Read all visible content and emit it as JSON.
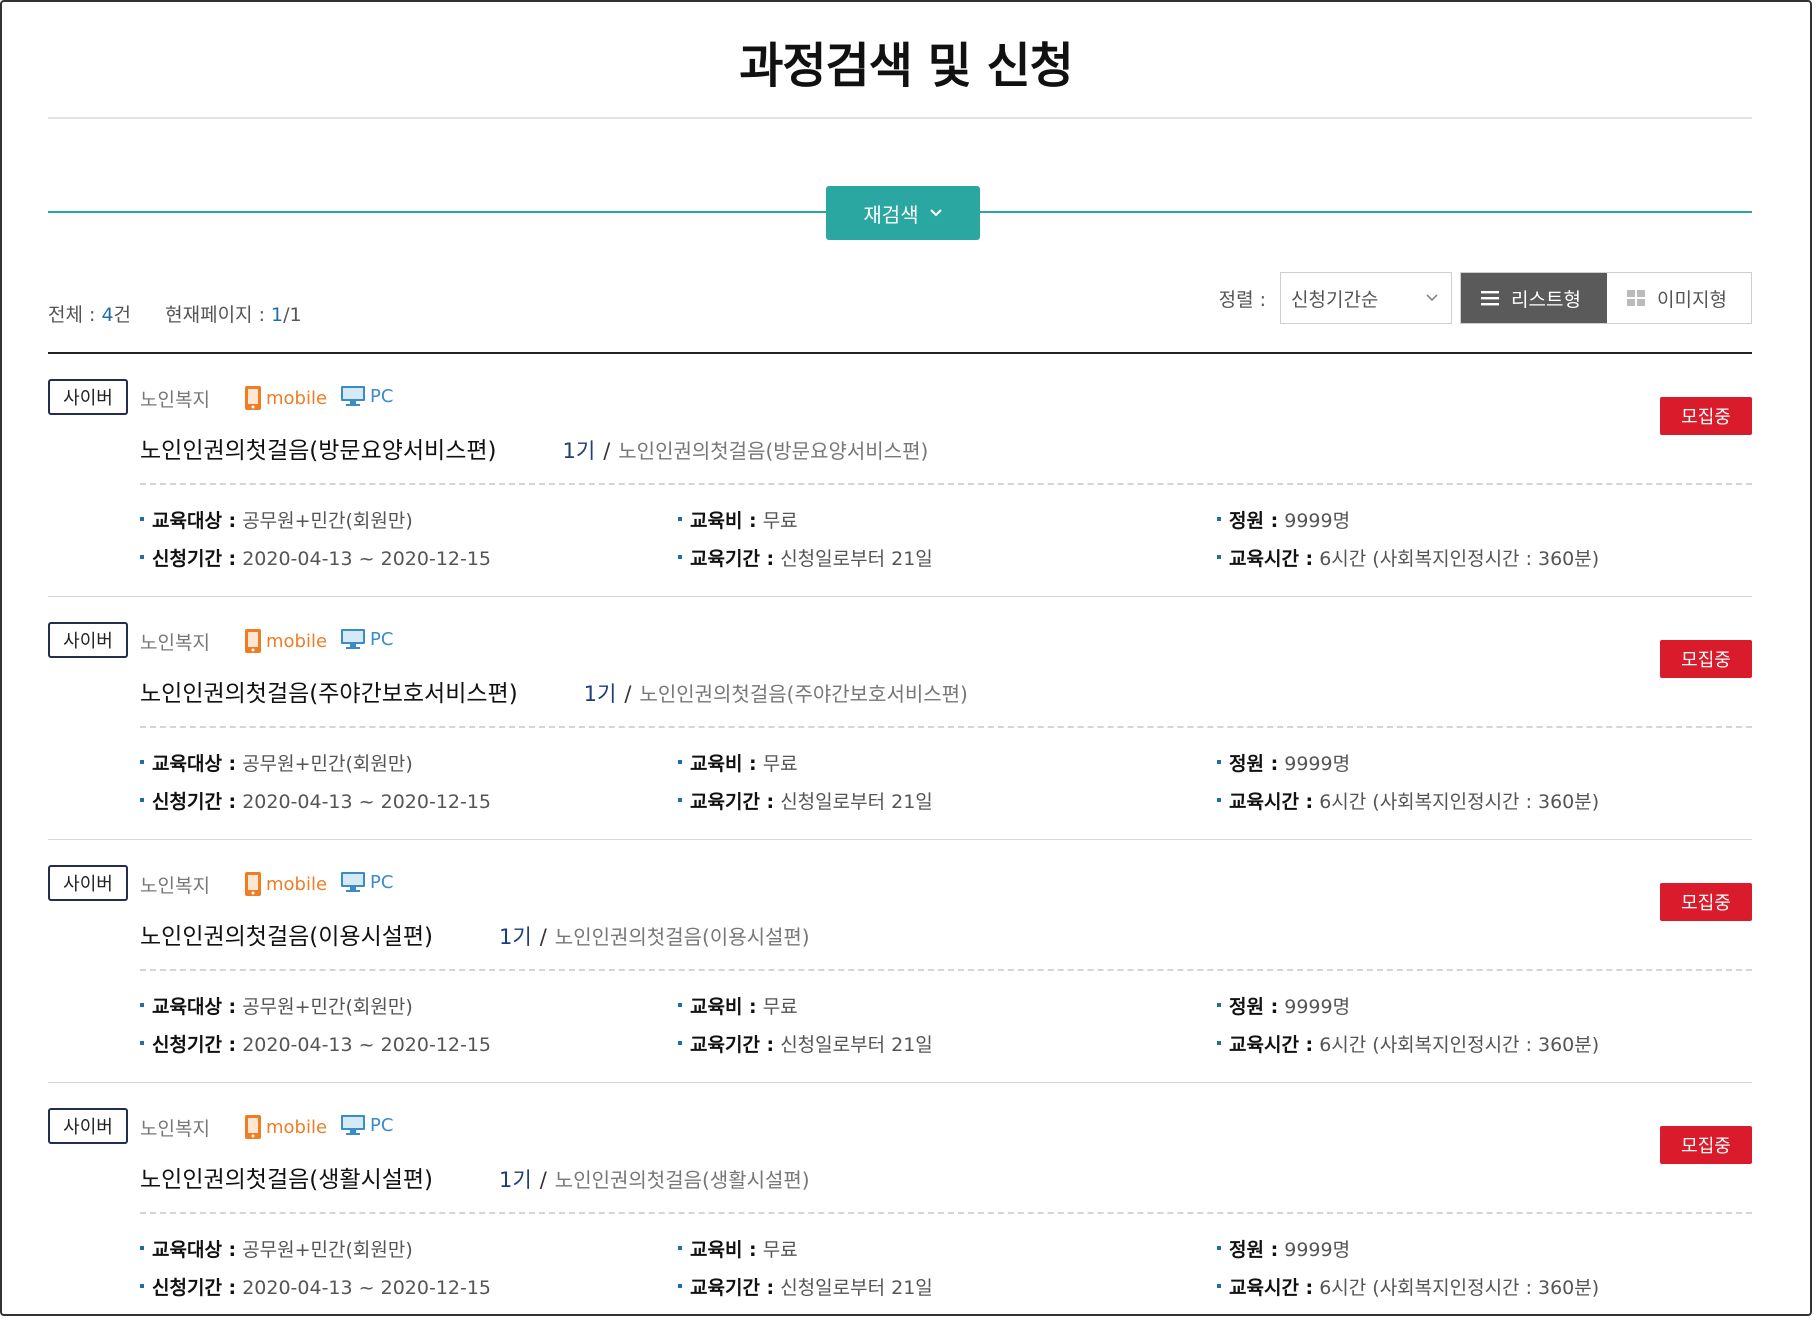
{
  "page": {
    "title": "과정검색 및 신청"
  },
  "search": {
    "research_label": "재검색"
  },
  "summary": {
    "total_label": "전체 :",
    "total_count": "4",
    "total_unit": "건",
    "page_label": "현재페이지 :",
    "current_page": "1",
    "total_pages": "/1"
  },
  "sort": {
    "label": "정렬 :",
    "selected": "신청기간순",
    "view_list_label": "리스트형",
    "view_image_label": "이미지형",
    "active_view": "list"
  },
  "colors": {
    "accent": "#2ba7a1",
    "status": "#d91b2c",
    "mobile": "#ee7d24",
    "pc": "#3a8cc9"
  },
  "icons": [
    "chevron-down-icon",
    "list-icon",
    "grid-icon",
    "mobile-icon",
    "pc-icon"
  ],
  "courses": [
    {
      "type": "사이버",
      "category": "노인복지",
      "mobile_label": "mobile",
      "pc_label": "PC",
      "title": "노인인권의첫걸음(방문요양서비스편)",
      "round": "1기",
      "slash": "/",
      "subtitle": "노인인권의첫걸음(방문요양서비스편)",
      "status": "모집중",
      "target_label": "교육대상 :",
      "target": "공무원+민간(회원만)",
      "fee_label": "교육비 :",
      "fee": "무료",
      "capacity_label": "정원 :",
      "capacity": "9999명",
      "apply_period_label": "신청기간 :",
      "apply_period": "2020-04-13 ~ 2020-12-15",
      "edu_period_label": "교육기간 :",
      "edu_period": "신청일로부터 21일",
      "edu_hours_label": "교육시간 :",
      "edu_hours": "6시간 (사회복지인정시간 : 360분)"
    },
    {
      "type": "사이버",
      "category": "노인복지",
      "mobile_label": "mobile",
      "pc_label": "PC",
      "title": "노인인권의첫걸음(주야간보호서비스편)",
      "round": "1기",
      "slash": "/",
      "subtitle": "노인인권의첫걸음(주야간보호서비스편)",
      "status": "모집중",
      "target_label": "교육대상 :",
      "target": "공무원+민간(회원만)",
      "fee_label": "교육비 :",
      "fee": "무료",
      "capacity_label": "정원 :",
      "capacity": "9999명",
      "apply_period_label": "신청기간 :",
      "apply_period": "2020-04-13 ~ 2020-12-15",
      "edu_period_label": "교육기간 :",
      "edu_period": "신청일로부터 21일",
      "edu_hours_label": "교육시간 :",
      "edu_hours": "6시간 (사회복지인정시간 : 360분)"
    },
    {
      "type": "사이버",
      "category": "노인복지",
      "mobile_label": "mobile",
      "pc_label": "PC",
      "title": "노인인권의첫걸음(이용시설편)",
      "round": "1기",
      "slash": "/",
      "subtitle": "노인인권의첫걸음(이용시설편)",
      "status": "모집중",
      "target_label": "교육대상 :",
      "target": "공무원+민간(회원만)",
      "fee_label": "교육비 :",
      "fee": "무료",
      "capacity_label": "정원 :",
      "capacity": "9999명",
      "apply_period_label": "신청기간 :",
      "apply_period": "2020-04-13 ~ 2020-12-15",
      "edu_period_label": "교육기간 :",
      "edu_period": "신청일로부터 21일",
      "edu_hours_label": "교육시간 :",
      "edu_hours": "6시간 (사회복지인정시간 : 360분)"
    },
    {
      "type": "사이버",
      "category": "노인복지",
      "mobile_label": "mobile",
      "pc_label": "PC",
      "title": "노인인권의첫걸음(생활시설편)",
      "round": "1기",
      "slash": "/",
      "subtitle": "노인인권의첫걸음(생활시설편)",
      "status": "모집중",
      "target_label": "교육대상 :",
      "target": "공무원+민간(회원만)",
      "fee_label": "교육비 :",
      "fee": "무료",
      "capacity_label": "정원 :",
      "capacity": "9999명",
      "apply_period_label": "신청기간 :",
      "apply_period": "2020-04-13 ~ 2020-12-15",
      "edu_period_label": "교육기간 :",
      "edu_period": "신청일로부터 21일",
      "edu_hours_label": "교육시간 :",
      "edu_hours": "6시간 (사회복지인정시간 : 360분)"
    }
  ]
}
